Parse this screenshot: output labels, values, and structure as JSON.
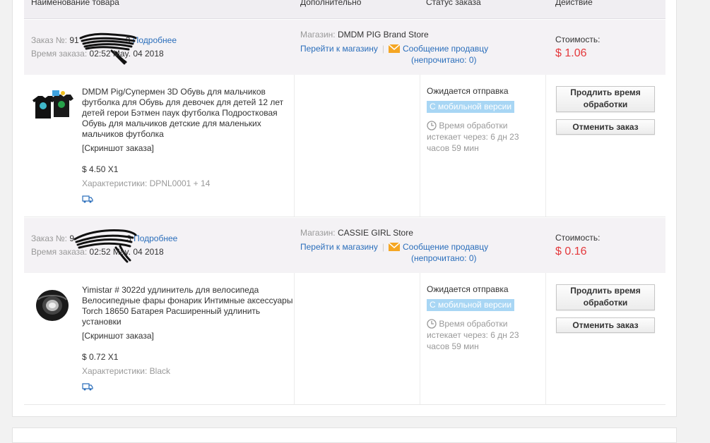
{
  "header": {
    "col_product": "Наименование товара",
    "col_extra": "Дополнительно",
    "col_status": "Статус заказа",
    "col_action": "Действие"
  },
  "orders": [
    {
      "order_label": "Заказ №:",
      "order_prefix": "91",
      "order_suffix": "3",
      "details_link": "Подробнее",
      "time_label": "Время заказа:",
      "time_value": "02:52 May. 04 2018",
      "store_label": "Магазин:",
      "store_name": "DMDM PIG Brand Store",
      "go_store": "Перейти к магазину",
      "msg_seller": "Сообщение продавцу",
      "unread": "(непрочитано: 0)",
      "cost_label": "Стоимость:",
      "cost_value": "$ 1.06",
      "product_title": "DMDM Pig/Супермен 3D Обувь для мальчиков футболка для Обувь для девочек для детей 12 лет детей герои Бэтмен паук футболка Подростковая Обувь для мальчиков детские для маленьких мальчиков футболка",
      "snapshot": "[Скриншот заказа]",
      "price_qty": "$ 4.50 X1",
      "specs": "Характеристики: DPNL0001 + 14",
      "status": "Ожидается отправка",
      "mobile_badge": "С мобильной версии",
      "timer_label": "Время обработки",
      "timer_text": "истекает через: 6 дн 23 часов 59 мин",
      "btn_extend": "Продлить время обработки",
      "btn_cancel": "Отменить заказ"
    },
    {
      "order_label": "Заказ №:",
      "order_prefix": "9",
      "order_suffix": "3",
      "details_link": "Подробнее",
      "time_label": "Время заказа:",
      "time_value": "02:52 May. 04 2018",
      "store_label": "Магазин:",
      "store_name": "CASSIE GIRL Store",
      "go_store": "Перейти к магазину",
      "msg_seller": "Сообщение продавцу",
      "unread": "(непрочитано: 0)",
      "cost_label": "Стоимость:",
      "cost_value": "$ 0.16",
      "product_title": "Yimistar # 3022d удлинитель для велосипеда Велосипедные фары фонарик Интимные аксессуары Torch 18650 Батарея Расширенный удлинить установки",
      "snapshot": "[Скриншот заказа]",
      "price_qty": "$ 0.72 X1",
      "specs": "Характеристики: Black",
      "status": "Ожидается отправка",
      "mobile_badge": "С мобильной версии",
      "timer_label": "Время обработки",
      "timer_text": "истекает через: 6 дн 23 часов 59 мин",
      "btn_extend": "Продлить время обработки",
      "btn_cancel": "Отменить заказ"
    }
  ],
  "icons": {
    "mail": "envelope-icon",
    "clock": "clock-icon",
    "shipping": "truck-icon"
  },
  "colors": {
    "link": "#2a6ebb",
    "price": "#e4393c",
    "badge": "#a8d6f4",
    "mail": "#f5a623"
  }
}
